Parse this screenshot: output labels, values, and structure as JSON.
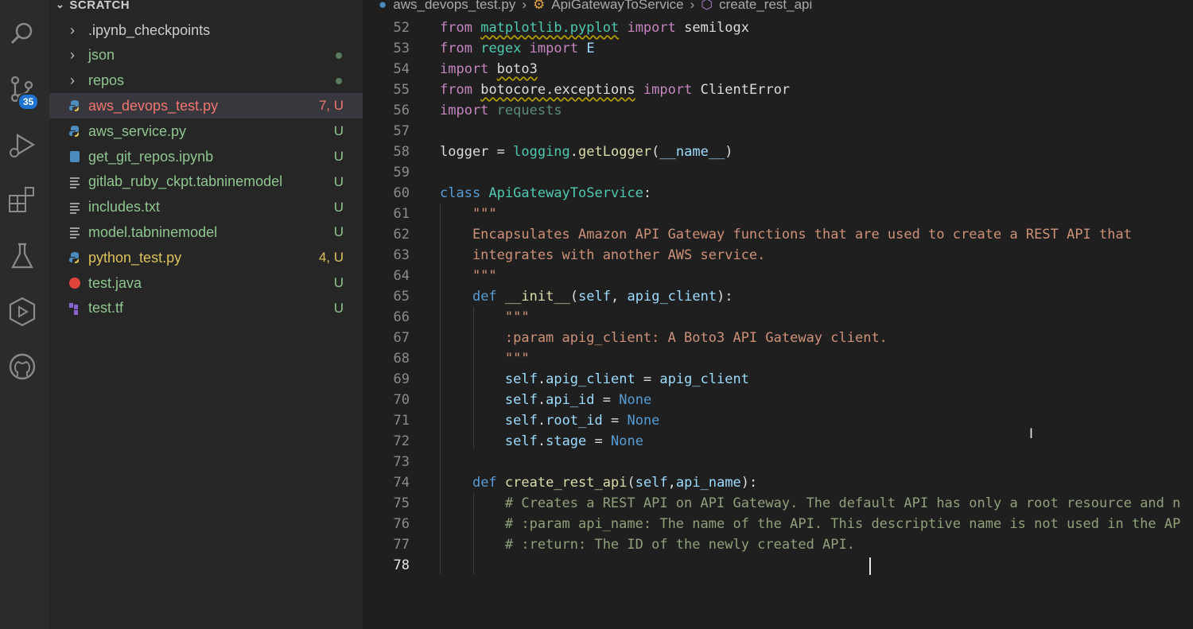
{
  "explorer": {
    "section_title": "SCRATCH",
    "items": [
      {
        "name": ".ipynb_checkpoints",
        "type": "folder",
        "status": "",
        "color": "#cccccc"
      },
      {
        "name": "json",
        "type": "folder",
        "status": "",
        "color": "#8fc58f"
      },
      {
        "name": "repos",
        "type": "folder",
        "status": "",
        "color": "#8fc58f"
      },
      {
        "name": "aws_devops_test.py",
        "type": "python",
        "status": "7, U",
        "color": "#f1766f"
      },
      {
        "name": "aws_service.py",
        "type": "python",
        "status": "U",
        "color": "#8fc58f"
      },
      {
        "name": "get_git_repos.ipynb",
        "type": "notebook",
        "status": "U",
        "color": "#8fc58f"
      },
      {
        "name": "gitlab_ruby_ckpt.tabninemodel",
        "type": "text",
        "status": "U",
        "color": "#8fc58f"
      },
      {
        "name": "includes.txt",
        "type": "text",
        "status": "U",
        "color": "#8fc58f"
      },
      {
        "name": "model.tabninemodel",
        "type": "text",
        "status": "U",
        "color": "#8fc58f"
      },
      {
        "name": "python_test.py",
        "type": "python",
        "status": "4, U",
        "color": "#dcc25a"
      },
      {
        "name": "test.java",
        "type": "java",
        "status": "U",
        "color": "#8fc58f"
      },
      {
        "name": "test.tf",
        "type": "terraform",
        "status": "U",
        "color": "#8fc58f"
      }
    ]
  },
  "activity_bar": {
    "icons": [
      "search-icon",
      "source-control-icon",
      "run-debug-icon",
      "extensions-icon",
      "testing-icon",
      "remote-explorer-icon",
      "github-icon"
    ],
    "source_control_badge": "35"
  },
  "breadcrumb": {
    "file": "aws_devops_test.py",
    "class": "ApiGatewayToService",
    "method": "create_rest_api"
  },
  "editor": {
    "line_numbers": [
      "52",
      "53",
      "54",
      "55",
      "56",
      "57",
      "58",
      "59",
      "60",
      "61",
      "62",
      "63",
      "64",
      "65",
      "66",
      "67",
      "68",
      "69",
      "70",
      "71",
      "72",
      "73",
      "74",
      "75",
      "76",
      "77",
      "78"
    ],
    "current_line": "78"
  }
}
